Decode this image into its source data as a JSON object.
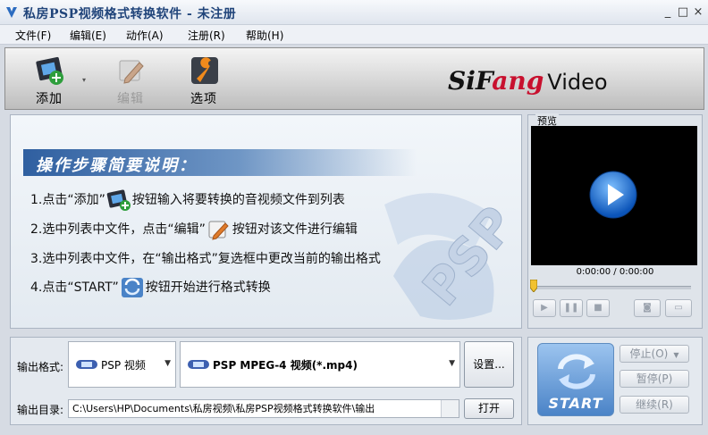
{
  "window": {
    "title": "私房PSP视频格式转换软件 - 未注册",
    "minimize": "_",
    "maximize": "□",
    "close": "×"
  },
  "menu": {
    "items": [
      "文件(F)",
      "编辑(E)",
      "动作(A)",
      "注册(R)",
      "帮助(H)"
    ]
  },
  "toolbar": {
    "add_label": "添加",
    "edit_label": "编辑",
    "options_label": "选项",
    "brand_part1": "SiF",
    "brand_part2": "ang",
    "brand_part3": "Video"
  },
  "instructions": {
    "title": "操作步骤简要说明：",
    "step1_a": "1.点击“添加”",
    "step1_b": "按钮输入将要转换的音视频文件到列表",
    "step2_a": "2.选中列表中文件，点击“编辑”",
    "step2_b": "按钮对该文件进行编辑",
    "step3": "3.选中列表中文件，在“输出格式”复选框中更改当前的输出格式",
    "step4_a": "4.点击“START”",
    "step4_b": "按钮开始进行格式转换",
    "watermark": "PSP"
  },
  "preview": {
    "label": "预览",
    "time": "0:00:00 / 0:00:00",
    "progress": 0
  },
  "output": {
    "format_label": "输出格式:",
    "device": "PSP 视频",
    "format": "PSP MPEG-4 视频(*.mp4)",
    "settings_button": "设置...",
    "dir_label": "输出目录:",
    "dir_value": "C:\\Users\\HP\\Documents\\私房视频\\私房PSP视频格式转换软件\\输出",
    "open_button": "打开"
  },
  "actions": {
    "start": "START",
    "stop": "停止(O)",
    "pause": "暂停(P)",
    "resume": "继续(R)"
  },
  "colors": {
    "accent": "#2f5fa0",
    "brand_red": "#c8102e",
    "play_blue": "#1e7be0"
  }
}
